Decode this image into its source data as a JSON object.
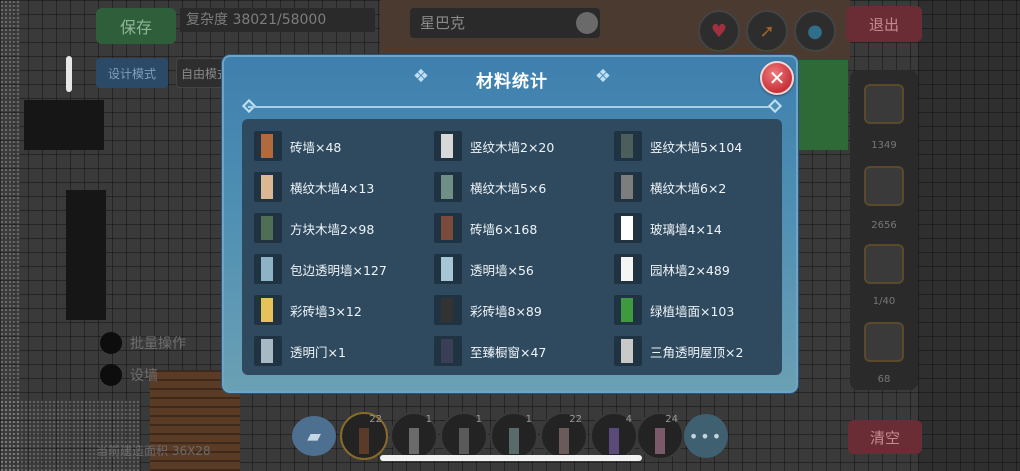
{
  "background": {
    "save_label": "保存",
    "complexity_label": "复杂度 38021/58000",
    "design_mode_label": "设计模式",
    "free_mode_label": "自由模式",
    "shop_name": "星巴克",
    "exit_label": "退出",
    "clear_label": "清空",
    "batch_op_label": "批量操作",
    "fence_label": "设墙",
    "area_label": "当前建造面积 36X28",
    "right_panel_counts": [
      "1349",
      "2656",
      "1/40",
      "68"
    ],
    "toolbar_slots": [
      "22",
      "1",
      "1",
      "1",
      "22",
      "4",
      "24"
    ],
    "more_label": "•••",
    "top_icons": [
      "heart-icon",
      "share-icon",
      "water-drop-icon"
    ]
  },
  "modal": {
    "title": "材料统计",
    "close_label": "✕",
    "items": [
      {
        "label": "砖墙×48",
        "color": "#b06a3e"
      },
      {
        "label": "竖纹木墙2×20",
        "color": "#d8d8d8"
      },
      {
        "label": "竖纹木墙5×104",
        "color": "#4c5e5c"
      },
      {
        "label": "横纹木墙4×13",
        "color": "#d9b893"
      },
      {
        "label": "横纹木墙5×6",
        "color": "#6f8e86"
      },
      {
        "label": "横纹木墙6×2",
        "color": "#7d7d7d"
      },
      {
        "label": "方块木墙2×98",
        "color": "#4f6e55"
      },
      {
        "label": "砖墙6×168",
        "color": "#7a4a3a"
      },
      {
        "label": "玻璃墙4×14",
        "color": "#ffffff"
      },
      {
        "label": "包边透明墙×127",
        "color": "#8fb3c6"
      },
      {
        "label": "透明墙×56",
        "color": "#a6c6d6"
      },
      {
        "label": "园林墙2×489",
        "color": "#f5f5f5"
      },
      {
        "label": "彩砖墙3×12",
        "color": "#e6c25a"
      },
      {
        "label": "彩砖墙8×89",
        "color": "#333333"
      },
      {
        "label": "绿植墙面×103",
        "color": "#3f9a3f"
      },
      {
        "label": "透明门×1",
        "color": "#a7b9c4"
      },
      {
        "label": "至臻橱窗×47",
        "color": "#3a3f55"
      },
      {
        "label": "三角透明屋顶×2",
        "color": "#c9c9c9"
      }
    ]
  }
}
